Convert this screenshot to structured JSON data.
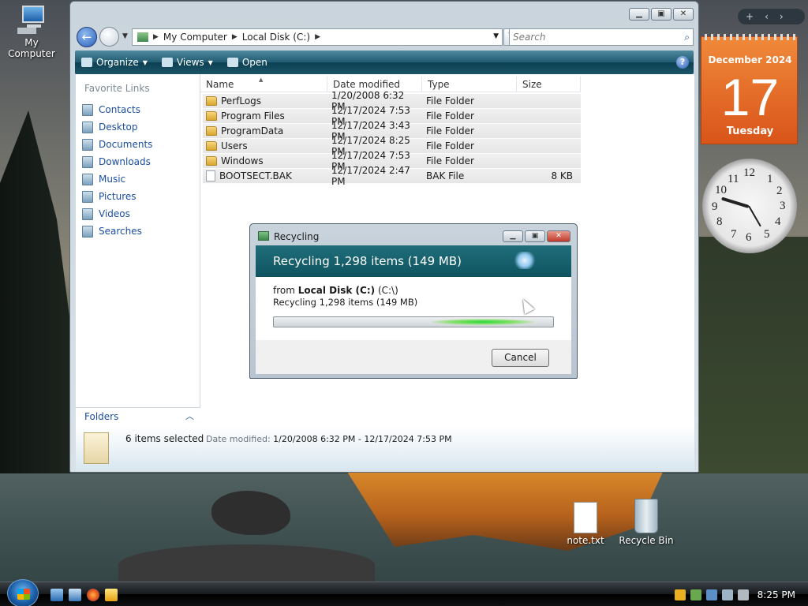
{
  "desktop": {
    "icons": [
      {
        "label": "My Computer"
      },
      {
        "label": "note.txt"
      },
      {
        "label": "Recycle Bin"
      }
    ]
  },
  "explorer": {
    "address": {
      "crumbs": [
        "My Computer",
        "Local Disk (C:)"
      ]
    },
    "search_placeholder": "Search",
    "toolbar": {
      "organize": "Organize",
      "views": "Views",
      "open": "Open"
    },
    "favorites": {
      "title": "Favorite Links",
      "items": [
        "Contacts",
        "Desktop",
        "Documents",
        "Downloads",
        "Music",
        "Pictures",
        "Videos",
        "Searches"
      ]
    },
    "folders_label": "Folders",
    "columns": [
      "Name",
      "Date modified",
      "Type",
      "Size"
    ],
    "rows": [
      {
        "name": "PerfLogs",
        "date": "1/20/2008 6:32 PM",
        "type": "File Folder",
        "size": "",
        "icon": "folder-icon"
      },
      {
        "name": "Program Files",
        "date": "12/17/2024 7:53 PM",
        "type": "File Folder",
        "size": "",
        "icon": "folder-icon"
      },
      {
        "name": "ProgramData",
        "date": "12/17/2024 3:43 PM",
        "type": "File Folder",
        "size": "",
        "icon": "folder-icon"
      },
      {
        "name": "Users",
        "date": "12/17/2024 8:25 PM",
        "type": "File Folder",
        "size": "",
        "icon": "folder-icon"
      },
      {
        "name": "Windows",
        "date": "12/17/2024 7:53 PM",
        "type": "File Folder",
        "size": "",
        "icon": "folder-icon"
      },
      {
        "name": "BOOTSECT.BAK",
        "date": "12/17/2024 2:47 PM",
        "type": "BAK File",
        "size": "8 KB",
        "icon": "file-icon"
      }
    ],
    "details": {
      "count": "6 items selected",
      "date_label": "Date modified:",
      "date_value": "1/20/2008 6:32 PM - 12/17/2024 7:53 PM"
    }
  },
  "dialog": {
    "title": "Recycling",
    "heading": "Recycling 1,298 items (149 MB)",
    "from_prefix": "from",
    "from_bold": "Local Disk (C:)",
    "from_path": "(C:\\)",
    "subtext": "Recycling 1,298 items (149 MB)",
    "cancel": "Cancel"
  },
  "gadgets": {
    "calendar": {
      "month": "December 2024",
      "day": "17",
      "weekday": "Tuesday"
    },
    "clock": {
      "numbers": [
        "12",
        "1",
        "2",
        "3",
        "4",
        "5",
        "6",
        "7",
        "8",
        "9",
        "10",
        "11"
      ]
    }
  },
  "taskbar": {
    "time": "8:25 PM"
  },
  "colors": {
    "toolbar": "#1b5568",
    "dialog_header": "#0f5360",
    "calendar": "#e06020",
    "link": "#1c4fa0"
  }
}
